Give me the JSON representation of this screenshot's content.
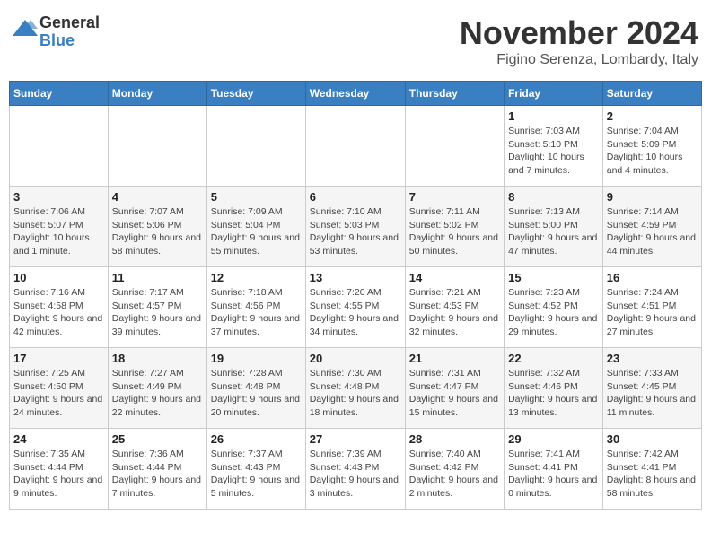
{
  "logo": {
    "general": "General",
    "blue": "Blue"
  },
  "header": {
    "month": "November 2024",
    "location": "Figino Serenza, Lombardy, Italy"
  },
  "days_of_week": [
    "Sunday",
    "Monday",
    "Tuesday",
    "Wednesday",
    "Thursday",
    "Friday",
    "Saturday"
  ],
  "weeks": [
    [
      {
        "day": "",
        "info": ""
      },
      {
        "day": "",
        "info": ""
      },
      {
        "day": "",
        "info": ""
      },
      {
        "day": "",
        "info": ""
      },
      {
        "day": "",
        "info": ""
      },
      {
        "day": "1",
        "info": "Sunrise: 7:03 AM\nSunset: 5:10 PM\nDaylight: 10 hours and 7 minutes."
      },
      {
        "day": "2",
        "info": "Sunrise: 7:04 AM\nSunset: 5:09 PM\nDaylight: 10 hours and 4 minutes."
      }
    ],
    [
      {
        "day": "3",
        "info": "Sunrise: 7:06 AM\nSunset: 5:07 PM\nDaylight: 10 hours and 1 minute."
      },
      {
        "day": "4",
        "info": "Sunrise: 7:07 AM\nSunset: 5:06 PM\nDaylight: 9 hours and 58 minutes."
      },
      {
        "day": "5",
        "info": "Sunrise: 7:09 AM\nSunset: 5:04 PM\nDaylight: 9 hours and 55 minutes."
      },
      {
        "day": "6",
        "info": "Sunrise: 7:10 AM\nSunset: 5:03 PM\nDaylight: 9 hours and 53 minutes."
      },
      {
        "day": "7",
        "info": "Sunrise: 7:11 AM\nSunset: 5:02 PM\nDaylight: 9 hours and 50 minutes."
      },
      {
        "day": "8",
        "info": "Sunrise: 7:13 AM\nSunset: 5:00 PM\nDaylight: 9 hours and 47 minutes."
      },
      {
        "day": "9",
        "info": "Sunrise: 7:14 AM\nSunset: 4:59 PM\nDaylight: 9 hours and 44 minutes."
      }
    ],
    [
      {
        "day": "10",
        "info": "Sunrise: 7:16 AM\nSunset: 4:58 PM\nDaylight: 9 hours and 42 minutes."
      },
      {
        "day": "11",
        "info": "Sunrise: 7:17 AM\nSunset: 4:57 PM\nDaylight: 9 hours and 39 minutes."
      },
      {
        "day": "12",
        "info": "Sunrise: 7:18 AM\nSunset: 4:56 PM\nDaylight: 9 hours and 37 minutes."
      },
      {
        "day": "13",
        "info": "Sunrise: 7:20 AM\nSunset: 4:55 PM\nDaylight: 9 hours and 34 minutes."
      },
      {
        "day": "14",
        "info": "Sunrise: 7:21 AM\nSunset: 4:53 PM\nDaylight: 9 hours and 32 minutes."
      },
      {
        "day": "15",
        "info": "Sunrise: 7:23 AM\nSunset: 4:52 PM\nDaylight: 9 hours and 29 minutes."
      },
      {
        "day": "16",
        "info": "Sunrise: 7:24 AM\nSunset: 4:51 PM\nDaylight: 9 hours and 27 minutes."
      }
    ],
    [
      {
        "day": "17",
        "info": "Sunrise: 7:25 AM\nSunset: 4:50 PM\nDaylight: 9 hours and 24 minutes."
      },
      {
        "day": "18",
        "info": "Sunrise: 7:27 AM\nSunset: 4:49 PM\nDaylight: 9 hours and 22 minutes."
      },
      {
        "day": "19",
        "info": "Sunrise: 7:28 AM\nSunset: 4:48 PM\nDaylight: 9 hours and 20 minutes."
      },
      {
        "day": "20",
        "info": "Sunrise: 7:30 AM\nSunset: 4:48 PM\nDaylight: 9 hours and 18 minutes."
      },
      {
        "day": "21",
        "info": "Sunrise: 7:31 AM\nSunset: 4:47 PM\nDaylight: 9 hours and 15 minutes."
      },
      {
        "day": "22",
        "info": "Sunrise: 7:32 AM\nSunset: 4:46 PM\nDaylight: 9 hours and 13 minutes."
      },
      {
        "day": "23",
        "info": "Sunrise: 7:33 AM\nSunset: 4:45 PM\nDaylight: 9 hours and 11 minutes."
      }
    ],
    [
      {
        "day": "24",
        "info": "Sunrise: 7:35 AM\nSunset: 4:44 PM\nDaylight: 9 hours and 9 minutes."
      },
      {
        "day": "25",
        "info": "Sunrise: 7:36 AM\nSunset: 4:44 PM\nDaylight: 9 hours and 7 minutes."
      },
      {
        "day": "26",
        "info": "Sunrise: 7:37 AM\nSunset: 4:43 PM\nDaylight: 9 hours and 5 minutes."
      },
      {
        "day": "27",
        "info": "Sunrise: 7:39 AM\nSunset: 4:43 PM\nDaylight: 9 hours and 3 minutes."
      },
      {
        "day": "28",
        "info": "Sunrise: 7:40 AM\nSunset: 4:42 PM\nDaylight: 9 hours and 2 minutes."
      },
      {
        "day": "29",
        "info": "Sunrise: 7:41 AM\nSunset: 4:41 PM\nDaylight: 9 hours and 0 minutes."
      },
      {
        "day": "30",
        "info": "Sunrise: 7:42 AM\nSunset: 4:41 PM\nDaylight: 8 hours and 58 minutes."
      }
    ]
  ]
}
